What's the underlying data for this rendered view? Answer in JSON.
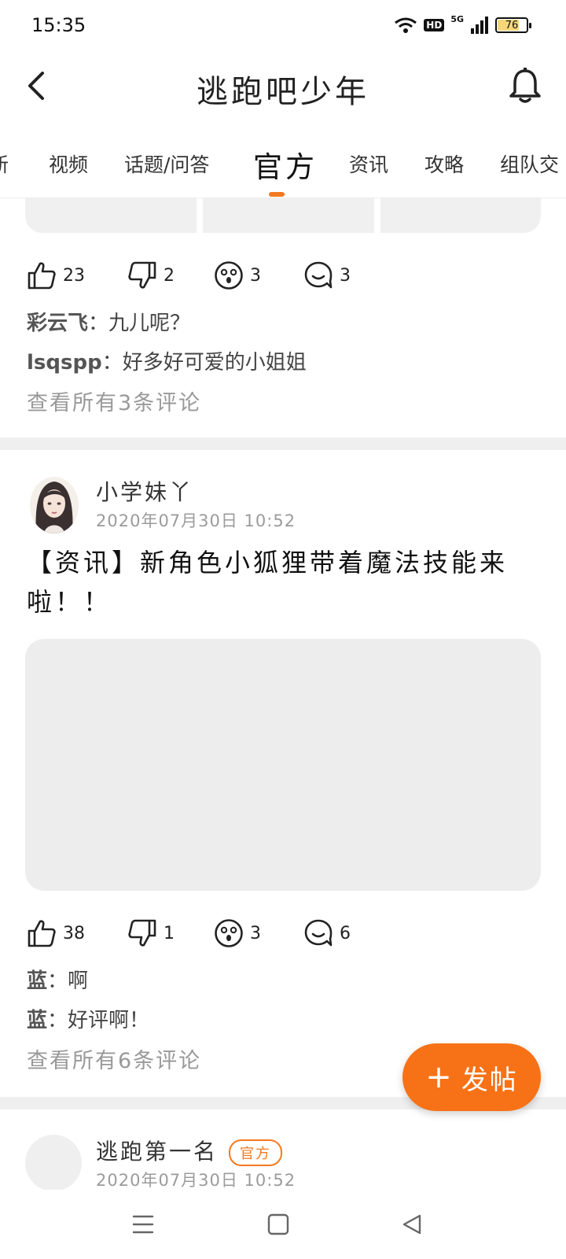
{
  "status_bar": {
    "time": "15:35",
    "hd": "HD",
    "network": "5G",
    "battery": "76",
    "battery_level": 0.76,
    "battery_color": "#f5d77a"
  },
  "header": {
    "title": "逃跑吧少年",
    "back_icon": "chevron-left-icon",
    "bell_icon": "bell-icon"
  },
  "tabs": {
    "items": [
      "新",
      "视频",
      "话题/问答",
      "官方",
      "资讯",
      "攻略",
      "组队交"
    ],
    "active": "官方",
    "accent": "#f47920"
  },
  "posts": [
    {
      "likes": "23",
      "dislikes": "2",
      "surprised": "3",
      "comments_count": "3",
      "comments": [
        {
          "author": "彩云飞",
          "sep": "：",
          "text": "九儿呢？"
        },
        {
          "author": "lsqspp",
          "sep": "：",
          "text": "好多好可爱的小姐姐"
        }
      ],
      "view_all": "查看所有3条评论"
    },
    {
      "author": "小学妹丫",
      "date": "2020年07月30日 10:52",
      "title": "【资讯】新角色小狐狸带着魔法技能来啦！！",
      "likes": "38",
      "dislikes": "1",
      "surprised": "3",
      "comments_count": "6",
      "comments": [
        {
          "author": "蓝",
          "sep": "：",
          "text": "啊"
        },
        {
          "author": "蓝",
          "sep": "：",
          "text": "好评啊！"
        }
      ],
      "view_all": "查看所有6条评论"
    },
    {
      "author": "逃跑第一名",
      "badge": "官方",
      "date": "2020年07月30日 10:52"
    }
  ],
  "fab": {
    "plus": "+",
    "label": "发帖",
    "color": "#f77216"
  },
  "nav": {
    "menu_icon": "menu-icon",
    "home_icon": "square-icon",
    "back_icon": "triangle-back-icon"
  }
}
